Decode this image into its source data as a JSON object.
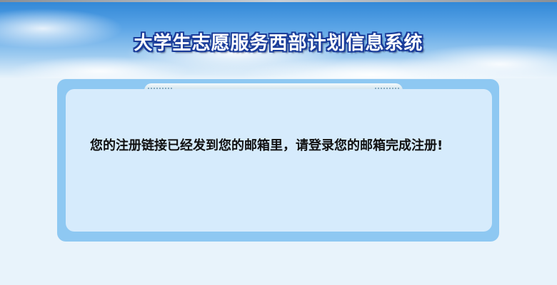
{
  "header": {
    "title": "大学生志愿服务西部计划信息系统"
  },
  "panel": {
    "message": "您的注册链接已经发到您的邮箱里，请登录您的邮箱完成注册!"
  },
  "colors": {
    "title_outline": "#1b3d9a",
    "panel_border": "#8ec8f2",
    "panel_fill": "#d6ebfc",
    "page_background": "#e8f3fb"
  }
}
